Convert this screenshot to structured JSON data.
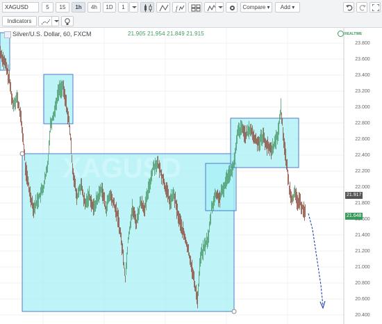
{
  "toolbar": {
    "symbol": "XAGUSD",
    "intervals": [
      "5",
      "15",
      "1h",
      "4h",
      "1D",
      "1"
    ],
    "active_interval": "1h",
    "compare_label": "Compare",
    "add_label": "Add",
    "indicators_label": "Indicators"
  },
  "legend": {
    "title": "Silver/U.S. Dollar, 60, FXCM",
    "values": "21.905 21.954 21.849 21.915",
    "realtime_badge": "REALTIME"
  },
  "price_axis": {
    "labels": [
      "23.800",
      "23.600",
      "23.400",
      "23.200",
      "23.000",
      "22.800",
      "22.600",
      "22.400",
      "22.200",
      "22.000",
      "21.800",
      "21.600",
      "21.400",
      "21.200",
      "21.000",
      "20.800",
      "20.600",
      "20.400"
    ],
    "current_price": "21.917",
    "marker_price": "21.648"
  },
  "colors": {
    "candle_up": "#4a9a6a",
    "candle_down": "#8a4a3a",
    "box_fill": "#a8f0f5",
    "box_stroke": "#2c5fbf",
    "arrow": "#1f3fb0",
    "current_tag": "#555555",
    "marker_tag": "#3a9a5b"
  }
}
